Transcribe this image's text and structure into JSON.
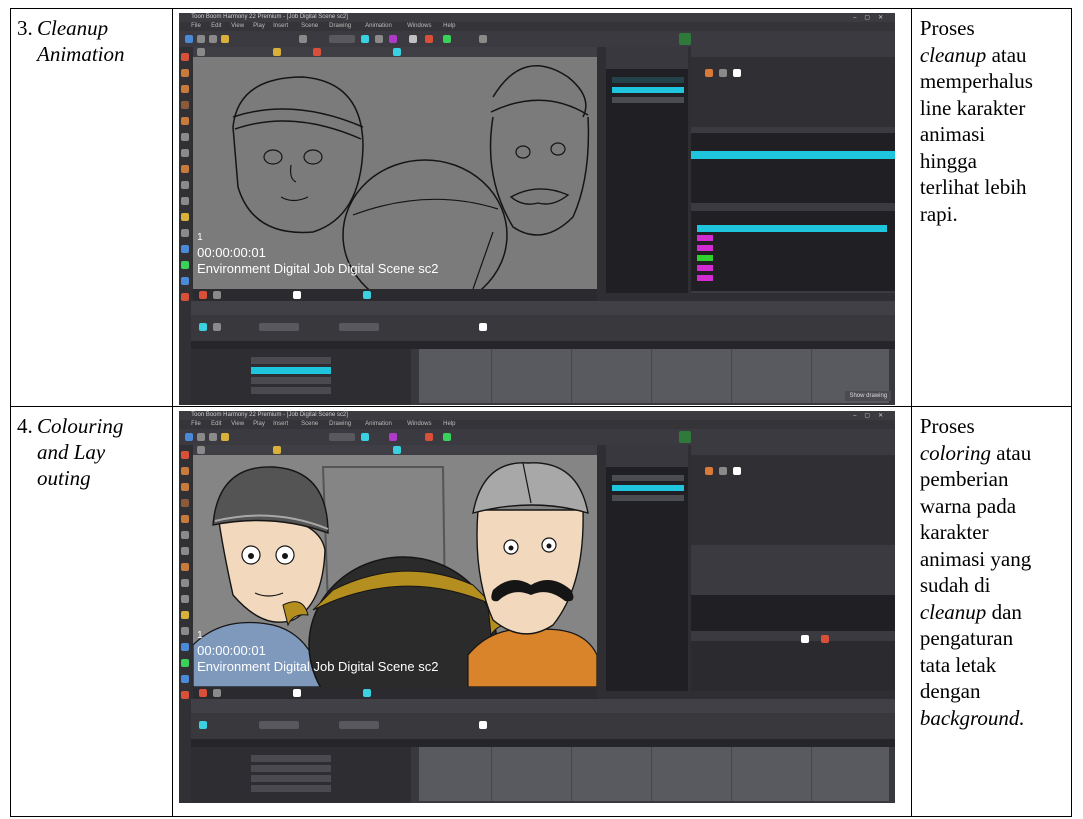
{
  "rows": [
    {
      "step_number": "3.",
      "step_title_lines": [
        "Cleanup",
        "Animation"
      ],
      "screenshot": {
        "window_title": "Toon Boom Harmony 22 Premium - [Job Digital Scene sc2]",
        "menu_items": [
          "File",
          "Edit",
          "View",
          "Play",
          "Insert",
          "Scene",
          "Drawing",
          "Animation",
          "Windows",
          "Help"
        ],
        "frame_number": "1",
        "timecode": "00:00:00:01",
        "scene_overlay": "Environment Digital Job Digital Scene sc2",
        "tooltip": "Show drawing",
        "colors": {
          "ui_dark": "#2e2e33",
          "accent_teal": "#1fc4dd",
          "magenta": "#d12bd1",
          "green": "#2fd12f",
          "canvas": "#7b7b7b",
          "line": "#151515"
        },
        "timeline_rows": 4,
        "palette_swatches": [
          "magenta",
          "magenta",
          "green",
          "magenta",
          "magenta"
        ]
      },
      "description_lines": [
        "Proses",
        "cleanup",
        "atau",
        "memperhalus",
        "line karakter",
        "animasi",
        "hingga",
        "terlihat lebih",
        "rapi."
      ]
    },
    {
      "step_number": "4.",
      "step_title_lines": [
        "Colouring",
        "and Lay",
        "outing"
      ],
      "screenshot": {
        "window_title": "Toon Boom Harmony 22 Premium - [Job Digital Scene sc2]",
        "menu_items": [
          "File",
          "Edit",
          "View",
          "Play",
          "Insert",
          "Scene",
          "Drawing",
          "Animation",
          "Windows",
          "Help"
        ],
        "frame_number": "1",
        "timecode": "00:00:00:01",
        "scene_overlay": "Environment Digital Job Digital Scene sc2",
        "colors": {
          "skin": "#f2d9bd",
          "shirt_orange": "#d9842b",
          "shirt_blue": "#7f99bd",
          "cap_dark": "#545454",
          "cap_gray": "#a8a8a8",
          "pot": "#2b2b2b",
          "gold": "#b48f1f",
          "bg": "#858585"
        },
        "timeline_rows": 4
      },
      "description_lines": [
        "Proses",
        "coloring",
        "atau",
        "pemberian",
        "warna pada",
        "karakter",
        "animasi yang",
        "sudah di",
        "cleanup",
        "dan",
        "pengaturan",
        "tata letak",
        "dengan",
        "background."
      ]
    }
  ]
}
